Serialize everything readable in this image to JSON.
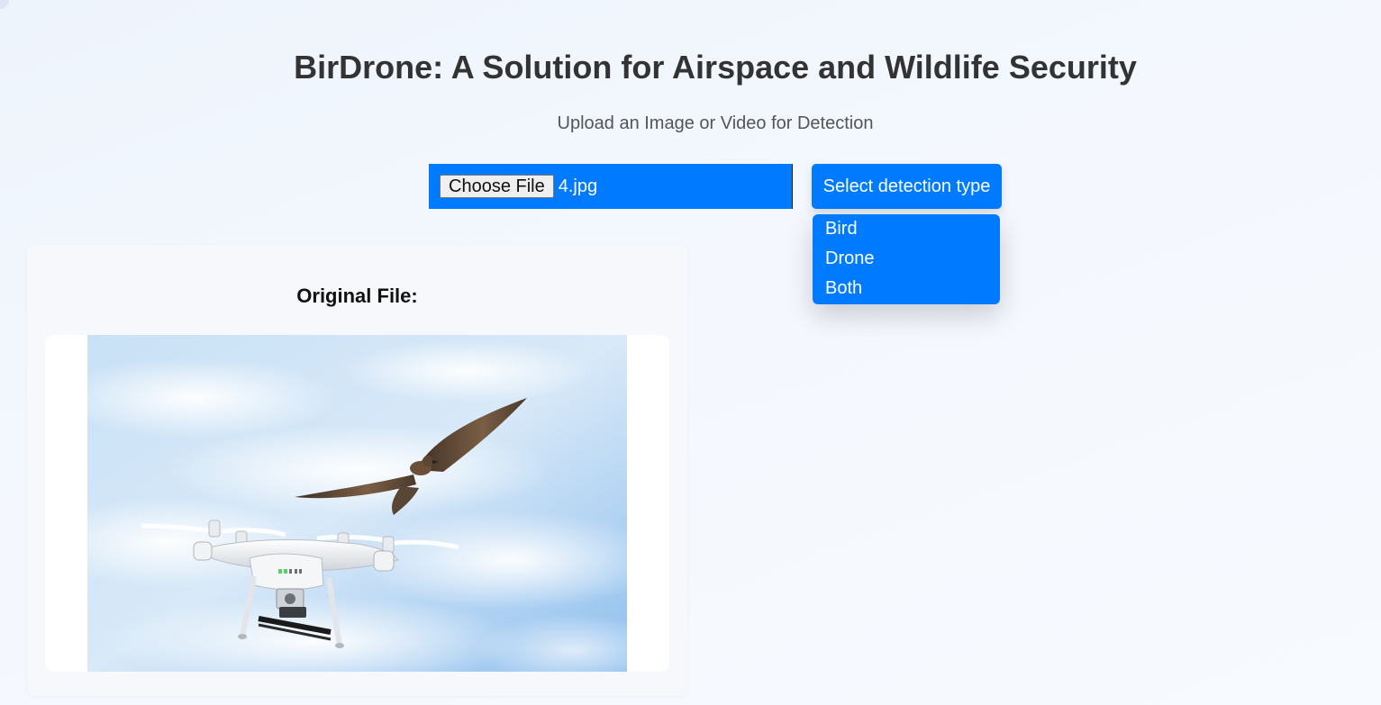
{
  "header": {
    "title": "BirDrone: A Solution for Airspace and Wildlife Security",
    "subtitle": "Upload an Image or Video for Detection"
  },
  "upload": {
    "choose_label": "Choose File",
    "file_name": "4.jpg"
  },
  "detection": {
    "button_label": "Select detection type",
    "options": [
      "Bird",
      "Drone",
      "Both"
    ]
  },
  "preview": {
    "title": "Original File:",
    "image_alt": "drone and bird in flight against a cloudy sky"
  },
  "colors": {
    "accent": "#007bff",
    "background": "#f4f8fe",
    "card": "#f6f8fb",
    "title_text": "#333333"
  }
}
